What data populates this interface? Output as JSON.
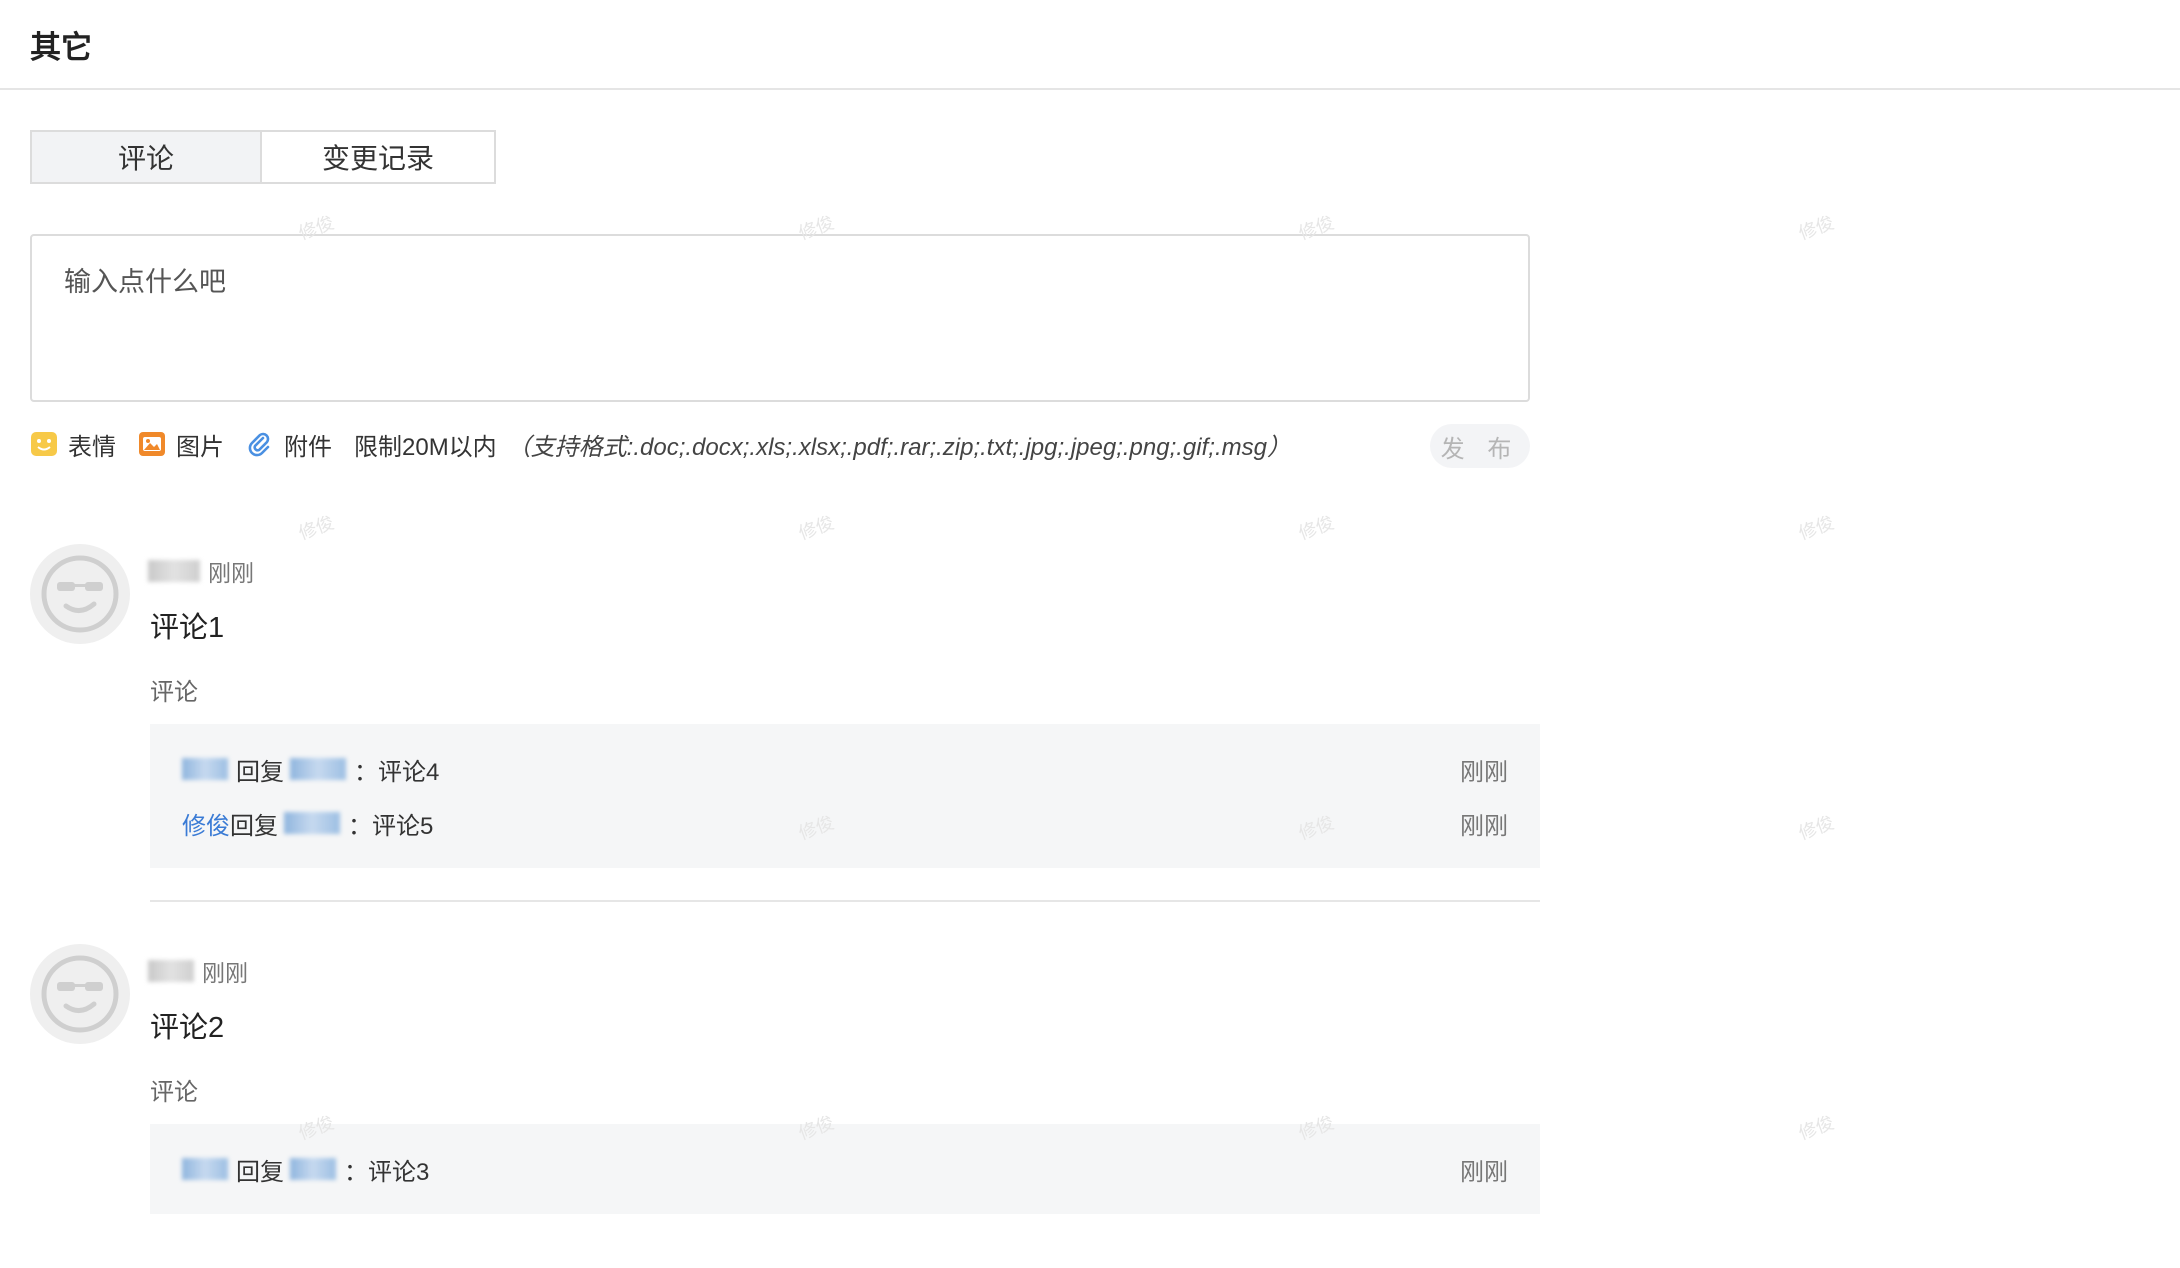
{
  "section": {
    "title": "其它"
  },
  "tabs": [
    {
      "label": "评论",
      "active": true
    },
    {
      "label": "变更记录",
      "active": false
    }
  ],
  "editor": {
    "placeholder": "输入点什么吧"
  },
  "toolbar": {
    "emoji": {
      "label": "表情",
      "icon": "emoji-icon"
    },
    "image": {
      "label": "图片",
      "icon": "image-icon"
    },
    "attach": {
      "label": "附件",
      "icon": "paperclip-icon"
    },
    "limit": "限制20M以内",
    "formats": "（支持格式:.doc;.docx;.xls;.xlsx;.pdf;.rar;.zip;.txt;.jpg;.jpeg;.png;.gif;.msg）",
    "publish_label": "发 布"
  },
  "comments": [
    {
      "time": "刚刚",
      "content": "评论1",
      "reply_label": "评论",
      "replies": [
        {
          "user_visible": "",
          "verb": "回复",
          "text": "：评论4",
          "time": "刚刚"
        },
        {
          "user_visible": "修俊",
          "verb": "回复",
          "text": "：评论5",
          "time": "刚刚"
        }
      ]
    },
    {
      "time": "刚刚",
      "content": "评论2",
      "reply_label": "评论",
      "replies": [
        {
          "user_visible": "",
          "verb": "回复",
          "text": "：评论3",
          "time": "刚刚"
        }
      ]
    }
  ],
  "colors": {
    "link": "#3a7bd5",
    "border": "#dcdcdc",
    "reply_bg": "#f5f6f7",
    "emoji": "#f7c948",
    "image": "#f0892a",
    "attach": "#4a90e2"
  }
}
